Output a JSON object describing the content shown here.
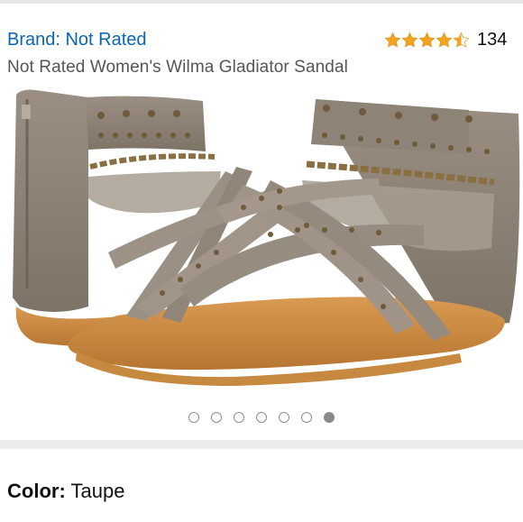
{
  "product": {
    "brand_label": "Brand: Not Rated",
    "title": "Not Rated Women's Wilma Gladiator Sandal",
    "rating_stars": 4.5,
    "rating_count": "134",
    "star_color": "#f4a31f"
  },
  "gallery": {
    "image_count": 7,
    "active_index": 6,
    "image_alt": "Taupe gladiator sandals with studded straps and chain detail"
  },
  "color": {
    "label": "Color:",
    "value": "Taupe"
  }
}
